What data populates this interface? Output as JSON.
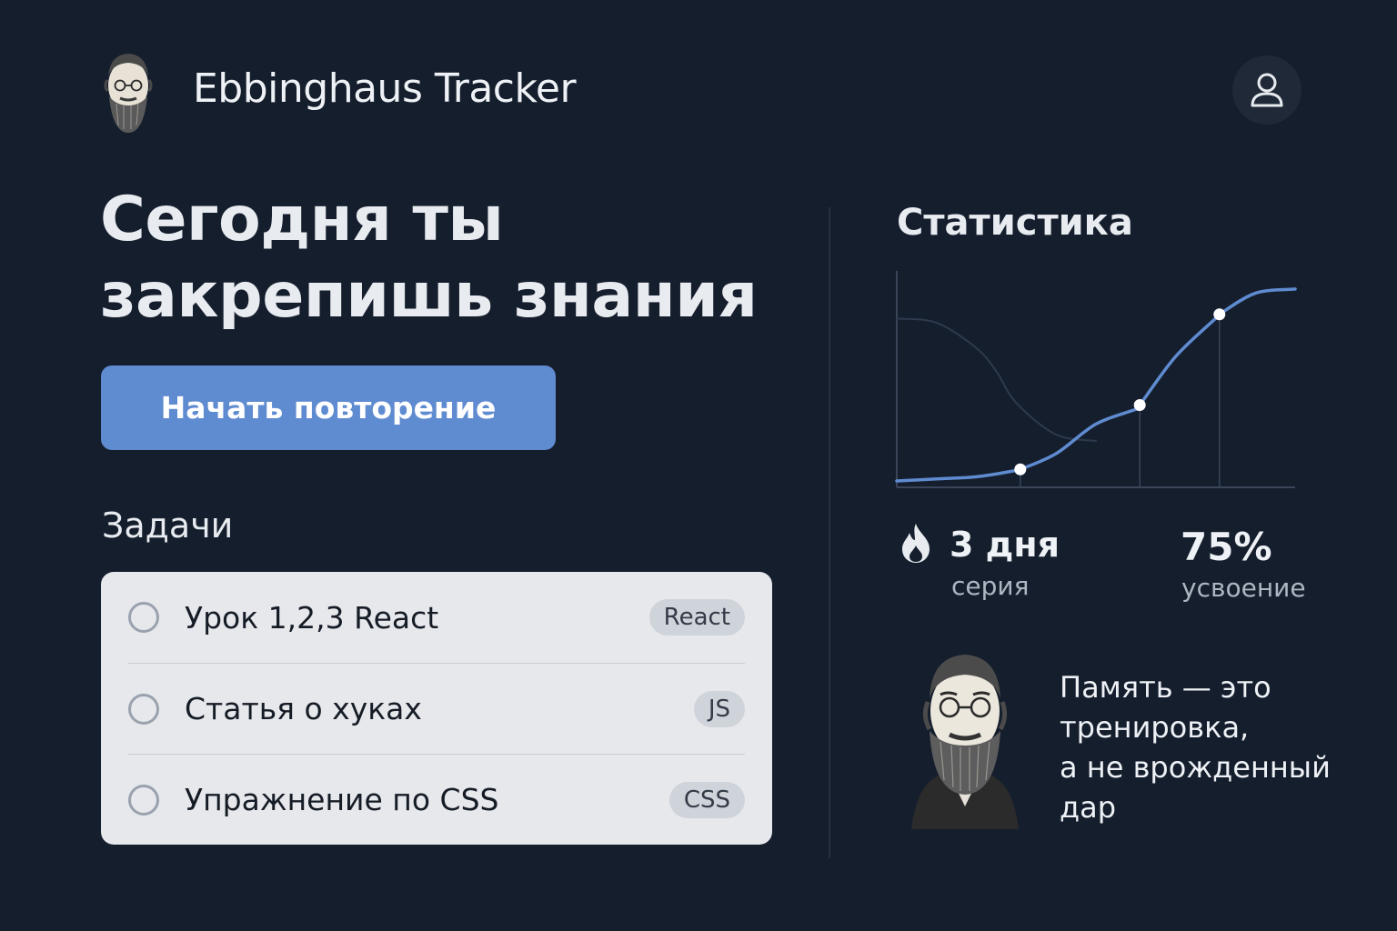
{
  "header": {
    "app_title": "Ebbinghaus Tracker",
    "logo_icon": "ebbinghaus-portrait",
    "profile_icon": "user-icon"
  },
  "hero": {
    "headline_line1": "Сегодня ты",
    "headline_line2": "закрепишь знания",
    "start_button": "Начать повторение"
  },
  "tasks": {
    "heading": "Задачи",
    "items": [
      {
        "label": "Урок 1,2,3 React",
        "tag": "React",
        "done": false
      },
      {
        "label": "Статья о хуках",
        "tag": "JS",
        "done": false
      },
      {
        "label": "Упражнение по CSS",
        "tag": "CSS",
        "done": false
      }
    ]
  },
  "stats": {
    "heading": "Статистика",
    "streak_value": "3 дня",
    "streak_label": "серия",
    "streak_icon": "flame-icon",
    "retention_value": "75%",
    "retention_label": "усвоение"
  },
  "chart_data": {
    "type": "line",
    "title": "",
    "xlabel": "",
    "ylabel": "",
    "grid": false,
    "xlim": [
      0,
      10
    ],
    "ylim": [
      0,
      100
    ],
    "series": [
      {
        "x": [
          0,
          1,
          2,
          3,
          3.1,
          4,
          5,
          6,
          6.1,
          7,
          8,
          8.1,
          9,
          10
        ],
        "values": [
          3,
          4,
          5,
          8,
          8.5,
          16,
          30,
          37,
          39,
          62,
          80,
          82,
          92,
          94
        ],
        "color": "#5f8bd0"
      },
      {
        "x": [
          0,
          1,
          2,
          2.5,
          3,
          4,
          5
        ],
        "values": [
          80,
          78,
          66,
          55,
          40,
          25,
          22
        ],
        "color": "#2e3a4d"
      }
    ],
    "markers": [
      {
        "x": 3.1,
        "y": 8.5
      },
      {
        "x": 6.1,
        "y": 39
      },
      {
        "x": 8.1,
        "y": 82
      }
    ]
  },
  "quote": {
    "line1": "Память — это",
    "line2": "тренировка,",
    "line3": "а не врожденный",
    "line4": "дар",
    "portrait_icon": "ebbinghaus-portrait"
  },
  "colors": {
    "background": "#151e2d",
    "accent": "#5f8bd0",
    "card": "#e6e8ec"
  }
}
